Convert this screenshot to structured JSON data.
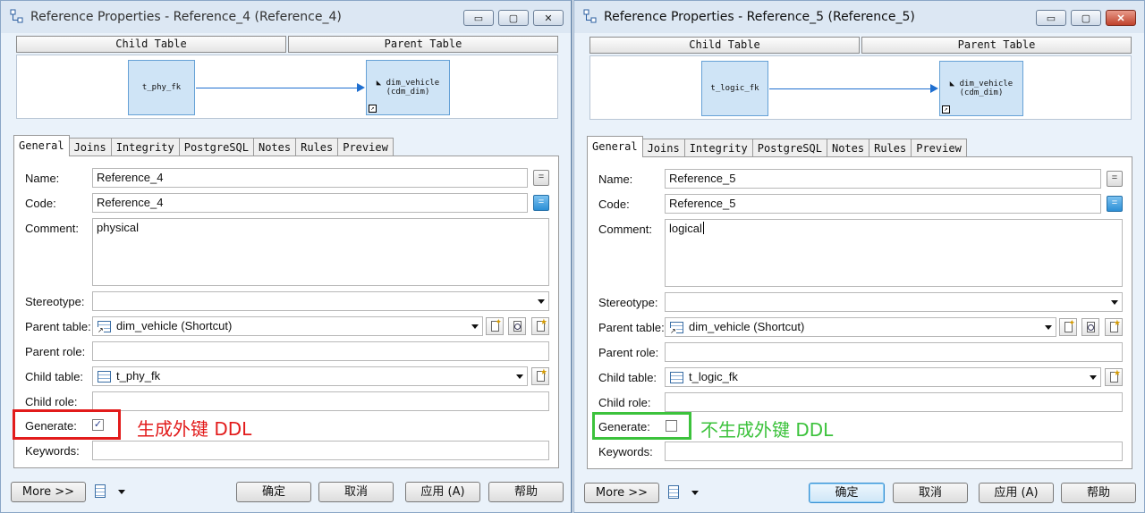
{
  "colors": {
    "title_bg": "#dce7f3",
    "dialog_bg": "#eaf2fa",
    "entity_fill": "#cfe4f6",
    "entity_border": "#66a1d6",
    "link_arrow": "#1f6fd0",
    "annotation_red": "#e21b1b",
    "annotation_green": "#3cc23c"
  },
  "left": {
    "title": "Reference Properties - Reference_4 (Reference_4)",
    "child_table_header": "Child Table",
    "parent_table_header": "Parent Table",
    "diagram": {
      "child_entity": "t_phy_fk",
      "parent_entity_name": "dim_vehicle",
      "parent_entity_owner": "(cdm_dim)"
    },
    "tabs": [
      "General",
      "Joins",
      "Integrity",
      "PostgreSQL",
      "Notes",
      "Rules",
      "Preview"
    ],
    "form": {
      "name_label": "Name:",
      "name_value": "Reference_4",
      "code_label": "Code:",
      "code_value": "Reference_4",
      "comment_label": "Comment:",
      "comment_value": "physical",
      "stereotype_label": "Stereotype:",
      "stereotype_value": "",
      "parent_table_label": "Parent table:",
      "parent_table_value": "dim_vehicle (Shortcut)",
      "parent_role_label": "Parent role:",
      "parent_role_value": "",
      "child_table_label": "Child table:",
      "child_table_value": "t_phy_fk",
      "child_role_label": "Child role:",
      "child_role_value": "",
      "generate_label": "Generate:",
      "generate_checked": true,
      "generate_mark": "✓",
      "keywords_label": "Keywords:",
      "keywords_value": ""
    },
    "annotation": "生成外键 DDL",
    "buttons": {
      "more": "More >>",
      "ok": "确定",
      "cancel": "取消",
      "apply": "应用 (A)",
      "help": "帮助"
    }
  },
  "right": {
    "title": "Reference Properties - Reference_5 (Reference_5)",
    "child_table_header": "Child Table",
    "parent_table_header": "Parent Table",
    "diagram": {
      "child_entity": "t_logic_fk",
      "parent_entity_name": "dim_vehicle",
      "parent_entity_owner": "(cdm_dim)"
    },
    "tabs": [
      "General",
      "Joins",
      "Integrity",
      "PostgreSQL",
      "Notes",
      "Rules",
      "Preview"
    ],
    "form": {
      "name_label": "Name:",
      "name_value": "Reference_5",
      "code_label": "Code:",
      "code_value": "Reference_5",
      "comment_label": "Comment:",
      "comment_value": "logical",
      "stereotype_label": "Stereotype:",
      "stereotype_value": "",
      "parent_table_label": "Parent table:",
      "parent_table_value": "dim_vehicle (Shortcut)",
      "parent_role_label": "Parent role:",
      "parent_role_value": "",
      "child_table_label": "Child table:",
      "child_table_value": "t_logic_fk",
      "child_role_label": "Child role:",
      "child_role_value": "",
      "generate_label": "Generate:",
      "generate_checked": false,
      "generate_mark": "",
      "keywords_label": "Keywords:",
      "keywords_value": ""
    },
    "annotation": "不生成外键 DDL",
    "buttons": {
      "more": "More >>",
      "ok": "确定",
      "cancel": "取消",
      "apply": "应用 (A)",
      "help": "帮助"
    }
  },
  "window_controls": {
    "minimize": "▭",
    "maximize": "▢",
    "close": "✕"
  },
  "icons": {
    "title": "reference-icon",
    "more_menu": "table-list-icon",
    "props": "properties-icon",
    "new": "new-object-icon",
    "browse": "browse-icon"
  }
}
